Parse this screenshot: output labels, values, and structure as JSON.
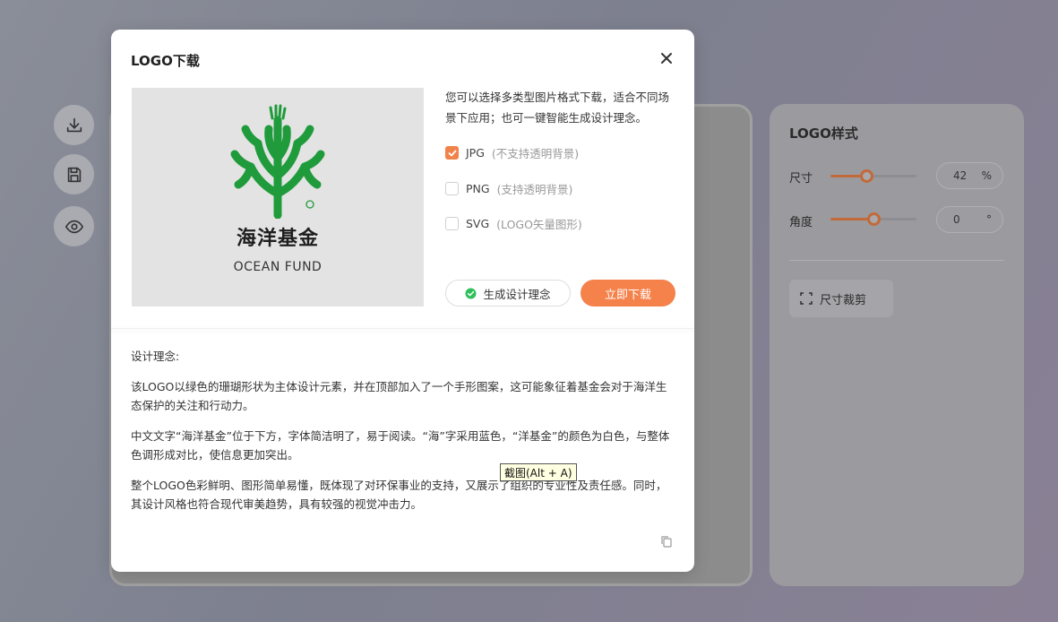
{
  "modal": {
    "title": "LOGO下载",
    "logo_cn": "海洋基金",
    "logo_en": "OCEAN FUND",
    "description": "您可以选择多类型图片格式下载，适合不同场景下应用；也可一键智能生成设计理念。",
    "options": [
      {
        "label": "JPG",
        "note": "(不支持透明背景)",
        "checked": true
      },
      {
        "label": "PNG",
        "note": "(支持透明背景)",
        "checked": false
      },
      {
        "label": "SVG",
        "note": "(LOGO矢量图形)",
        "checked": false
      }
    ],
    "generate_label": "生成设计理念",
    "download_label": "立即下载",
    "concept_title": "设计理念:",
    "concept_paragraphs": [
      "该LOGO以绿色的珊瑚形状为主体设计元素，并在顶部加入了一个手形图案，这可能象征着基金会对于海洋生态保护的关注和行动力。",
      "中文文字“海洋基金”位于下方，字体简洁明了，易于阅读。“海”字采用蓝色，“洋基金”的颜色为白色，与整体色调形成对比，使信息更加突出。",
      "整个LOGO色彩鲜明、图形简单易懂，既体现了对环保事业的支持，又展示了组织的专业性及责任感。同时，其设计风格也符合现代审美趋势，具有较强的视觉冲击力。"
    ]
  },
  "style_panel": {
    "title": "LOGO样式",
    "size_label": "尺寸",
    "size_value": "42",
    "size_unit": "%",
    "size_level": 0.42,
    "angle_label": "角度",
    "angle_value": "0",
    "angle_unit": "°",
    "angle_level": 0.5,
    "crop_label": "尺寸裁剪"
  },
  "tooltip": "截图(Alt + A)",
  "colors": {
    "accent": "#f5814b",
    "logo_green": "#1f9b3c",
    "check_green": "#2fbf5a"
  }
}
